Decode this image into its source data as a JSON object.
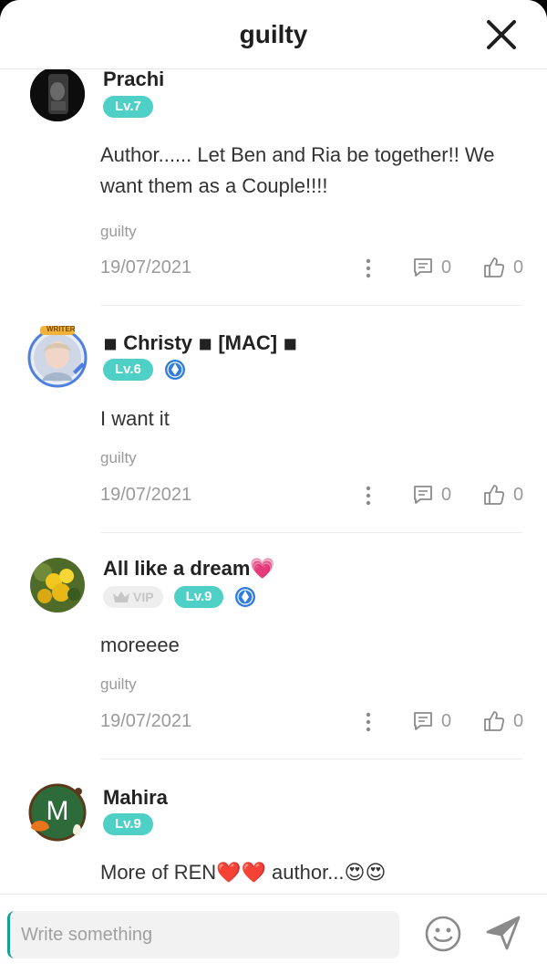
{
  "header": {
    "title": "guilty"
  },
  "comments": [
    {
      "username": "Prachi",
      "level": "Lv.7",
      "text": "Author...... Let Ben and Ria be together!! We want them as a Couple!!!!",
      "tag": "guilty",
      "date": "19/07/2021",
      "replies": "0",
      "likes": "0"
    },
    {
      "username": "◾ Christy ◾ [MAC] ◾",
      "level": "Lv.6",
      "text": "I want it",
      "tag": "guilty",
      "date": "19/07/2021",
      "replies": "0",
      "likes": "0",
      "frame_label": "WRITER"
    },
    {
      "username": "All like a dream💗",
      "vip": "VIP",
      "level": "Lv.9",
      "text": "moreeee",
      "tag": "guilty",
      "date": "19/07/2021",
      "replies": "0",
      "likes": "0"
    },
    {
      "username": "Mahira",
      "level": "Lv.9",
      "avatar_letter": "M",
      "text": "More of REN❤️❤️ author...😍😍"
    }
  ],
  "input": {
    "placeholder": "Write something"
  },
  "icons": {
    "close": "close-icon",
    "more": "more-vertical-icon",
    "reply": "comment-icon",
    "like": "thumbs-up-icon",
    "badge": "author-badge-icon",
    "emoji": "smiley-icon",
    "send": "send-icon"
  },
  "colors": {
    "level_badge": "#4fd0c6",
    "author_badge": "#2f7de1",
    "muted_text": "#9a9a9a",
    "cursor": "#16a095"
  }
}
